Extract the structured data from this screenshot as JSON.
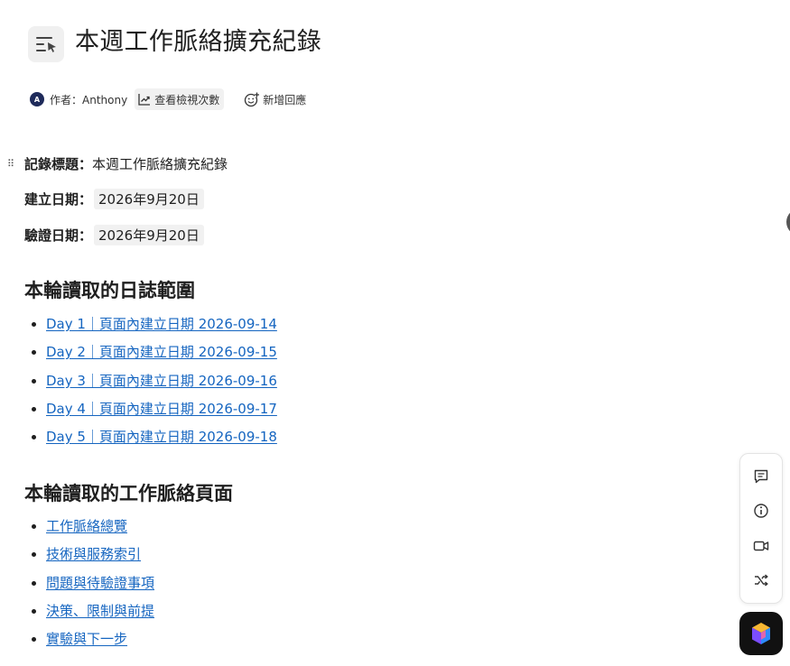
{
  "page": {
    "title": "本週工作脈絡擴充紀錄",
    "icon": "list-pointer-icon"
  },
  "meta": {
    "avatar_initial": "A",
    "author_label": "作者：Anthony",
    "views_label": "查看檢視次數",
    "reaction_label": "新增回應"
  },
  "fields": {
    "record_title_label": "記錄標題：",
    "record_title_value": "本週工作脈絡擴充紀錄",
    "created_label": "建立日期：",
    "created_value": "2026年9月20日",
    "verified_label": "驗證日期：",
    "verified_value": "2026年9月20日"
  },
  "sections": {
    "logs": {
      "heading": "本輪讀取的日誌範圍",
      "items": [
        "Day 1｜頁面內建立日期 2026-09-14",
        "Day 2｜頁面內建立日期 2026-09-15",
        "Day 3｜頁面內建立日期 2026-09-16",
        "Day 4｜頁面內建立日期 2026-09-17",
        "Day 5｜頁面內建立日期 2026-09-18"
      ]
    },
    "context": {
      "heading": "本輪讀取的工作脈絡頁面",
      "items": [
        "工作脈絡總覽",
        "技術與服務索引",
        "問題與待驗證事項",
        "決策、限制與前提",
        "實驗與下一步"
      ]
    }
  },
  "toolbar": {
    "icons": [
      "comment-icon",
      "info-icon",
      "video-icon",
      "shuffle-icon"
    ],
    "ai_icon": "ai-assistant-icon"
  },
  "colors": {
    "link": "#1565c0",
    "chip_bg": "#f1f1f1",
    "avatar_bg": "#1e2a5a"
  }
}
